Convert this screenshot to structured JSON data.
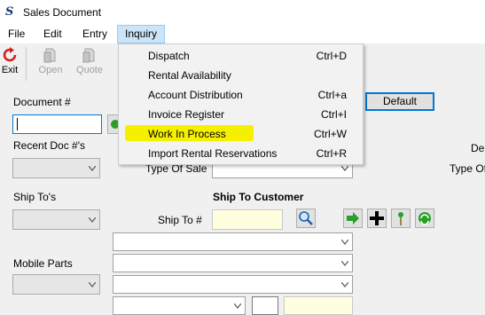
{
  "window": {
    "title": "Sales Document",
    "app_icon": "S"
  },
  "menubar": {
    "items": [
      "File",
      "Edit",
      "Entry",
      "Inquiry"
    ],
    "active": "Inquiry"
  },
  "toolbar": {
    "exit": "Exit",
    "open": "Open",
    "quote": "Quote"
  },
  "form": {
    "document_label": "Document #",
    "document_value": "",
    "recent_label": "Recent Doc #'s",
    "type_of_sale_label": "Type Of Sale",
    "type_of_sale_label_right": "Type Of",
    "dep_label": "Dep",
    "ship_tos_label": "Ship To's",
    "ship_to_customer_label": "Ship To Customer",
    "ship_to_label": "Ship To #",
    "mobile_parts_label": "Mobile Parts",
    "default_button": "Default"
  },
  "inquiry_menu": {
    "items": [
      {
        "label": "Dispatch",
        "shortcut": "Ctrl+D"
      },
      {
        "label": "Rental Availability",
        "shortcut": ""
      },
      {
        "label": "Account Distribution",
        "shortcut": "Ctrl+a"
      },
      {
        "label": "Invoice Register",
        "shortcut": "Ctrl+I"
      },
      {
        "label": "Work In Process",
        "shortcut": "Ctrl+W"
      },
      {
        "label": "Import Rental Reservations",
        "shortcut": "Ctrl+R"
      }
    ],
    "highlighted": "Work In Process",
    "highlight_color": "#ffff00"
  },
  "colors": {
    "accent": "#0078d7",
    "exit_red": "#d32020",
    "menu_active": "#cce4f7",
    "field_yellow": "#ffffe0",
    "green": "#2aa02a"
  }
}
